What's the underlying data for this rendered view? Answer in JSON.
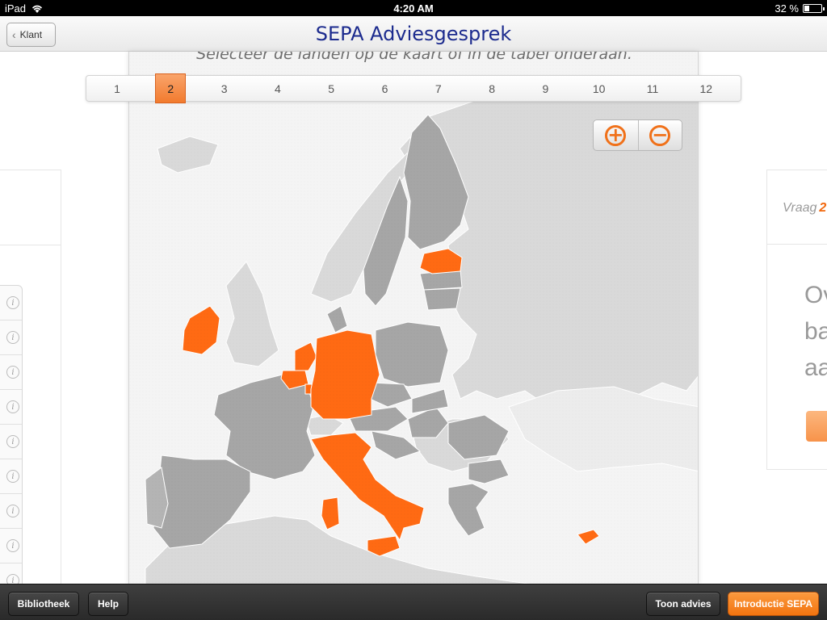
{
  "status": {
    "carrier": "iPad",
    "time": "4:20 AM",
    "battery": "32 %",
    "battery_level": 0.32
  },
  "navbar": {
    "title": "SEPA Adviesgesprek",
    "back_label": "Klant"
  },
  "main": {
    "instruction": "Selecteer de landen op de kaart of in de tabel onderaan.",
    "steps": [
      "1",
      "2",
      "3",
      "4",
      "5",
      "6",
      "7",
      "8",
      "9",
      "10",
      "11",
      "12"
    ],
    "active_step": "2"
  },
  "zoom": {
    "in_icon": "plus-circle-icon",
    "out_icon": "minus-circle-icon",
    "in_glyph": "+",
    "out_glyph": "−"
  },
  "right_panel": {
    "tab_label": "Vraag",
    "tab_number": "2",
    "text_lines": [
      "Ov",
      "ba",
      "aa"
    ]
  },
  "left_panel": {
    "info_glyph": "i"
  },
  "map": {
    "selected_countries": [
      "Ireland",
      "Netherlands",
      "Belgium",
      "Luxembourg",
      "Germany",
      "Italy",
      "Estonia",
      "Cyprus"
    ],
    "colors": {
      "selected": "#ff6a13",
      "eu": "#a6a6a6",
      "non_eu": "#d7d7d7",
      "sea": "#f4f4f4"
    }
  },
  "toolbar": {
    "library": "Bibliotheek",
    "help": "Help",
    "show_advice": "Toon advies",
    "intro": "Introductie SEPA"
  }
}
